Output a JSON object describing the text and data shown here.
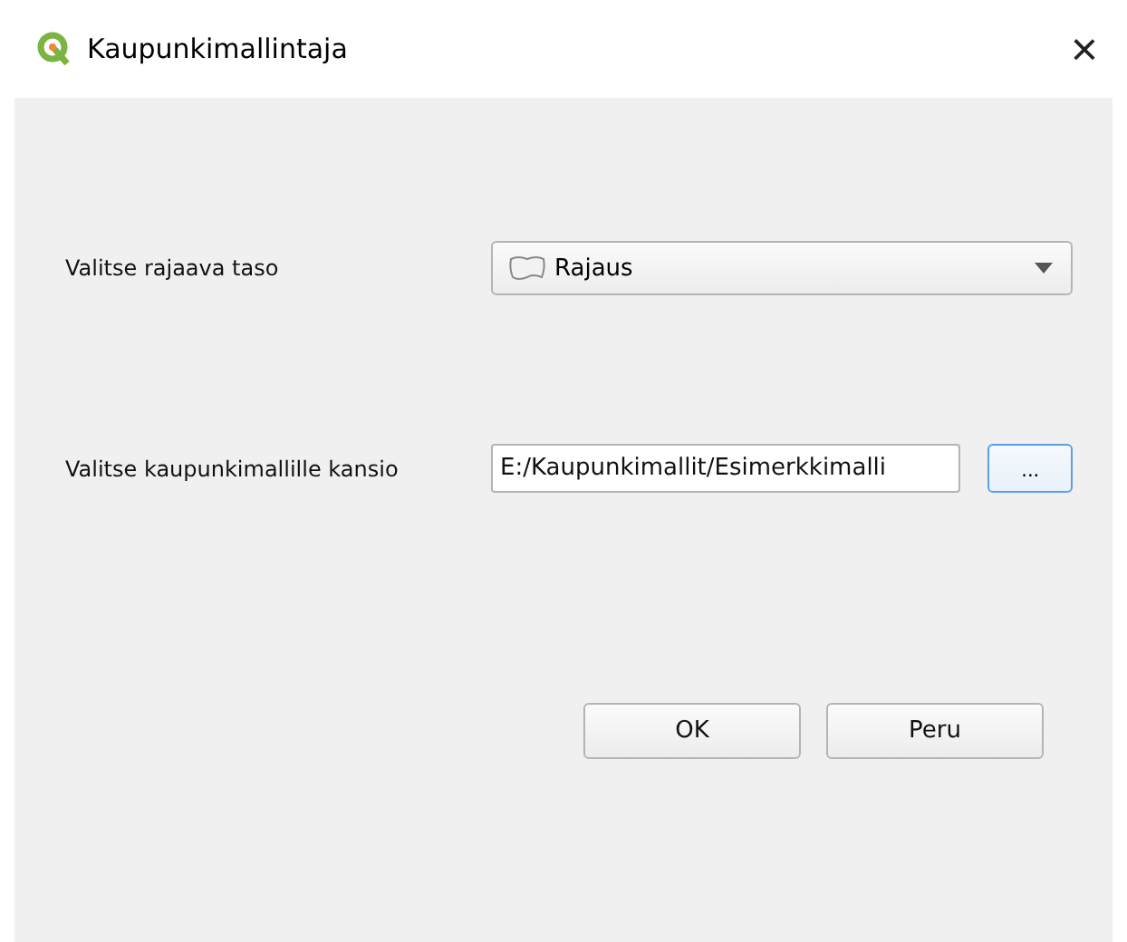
{
  "window": {
    "title": "Kaupunkimallintaja",
    "close": "×"
  },
  "boundary_layer": {
    "label": "Valitse rajaava taso",
    "value": "Rajaus"
  },
  "folder": {
    "label": "Valitse kaupunkimallille kansio",
    "value": "E:/Kaupunkimallit/Esimerkkimalli",
    "browse": "..."
  },
  "buttons": [
    "OK",
    "Peru"
  ]
}
